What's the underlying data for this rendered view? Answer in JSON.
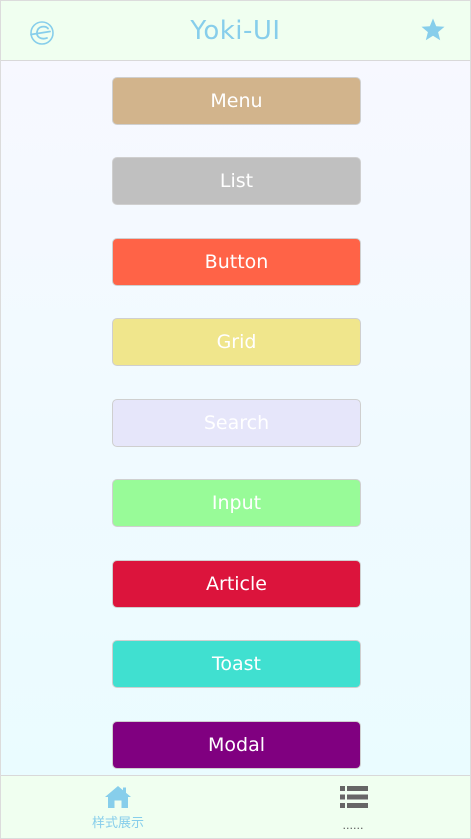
{
  "header": {
    "title": "Yoki-UI",
    "logo_icon": "e-logo-icon",
    "star_icon": "star-icon"
  },
  "buttons": [
    {
      "label": "Menu",
      "color": "#d2b48c"
    },
    {
      "label": "List",
      "color": "#c0c0c0"
    },
    {
      "label": "Button",
      "color": "#ff6347"
    },
    {
      "label": "Grid",
      "color": "#f0e68c"
    },
    {
      "label": "Search",
      "color": "#e6e6fa"
    },
    {
      "label": "Input",
      "color": "#98fb98"
    },
    {
      "label": "Article",
      "color": "#dc143c"
    },
    {
      "label": "Toast",
      "color": "#40e0d0"
    },
    {
      "label": "Modal",
      "color": "#800080"
    }
  ],
  "footer": {
    "tabs": [
      {
        "label": "样式展示",
        "icon": "home-icon"
      },
      {
        "label": "......",
        "icon": "list-icon"
      }
    ]
  },
  "colors": {
    "accent": "#87ceeb",
    "header_bg": "#f0fff0"
  }
}
